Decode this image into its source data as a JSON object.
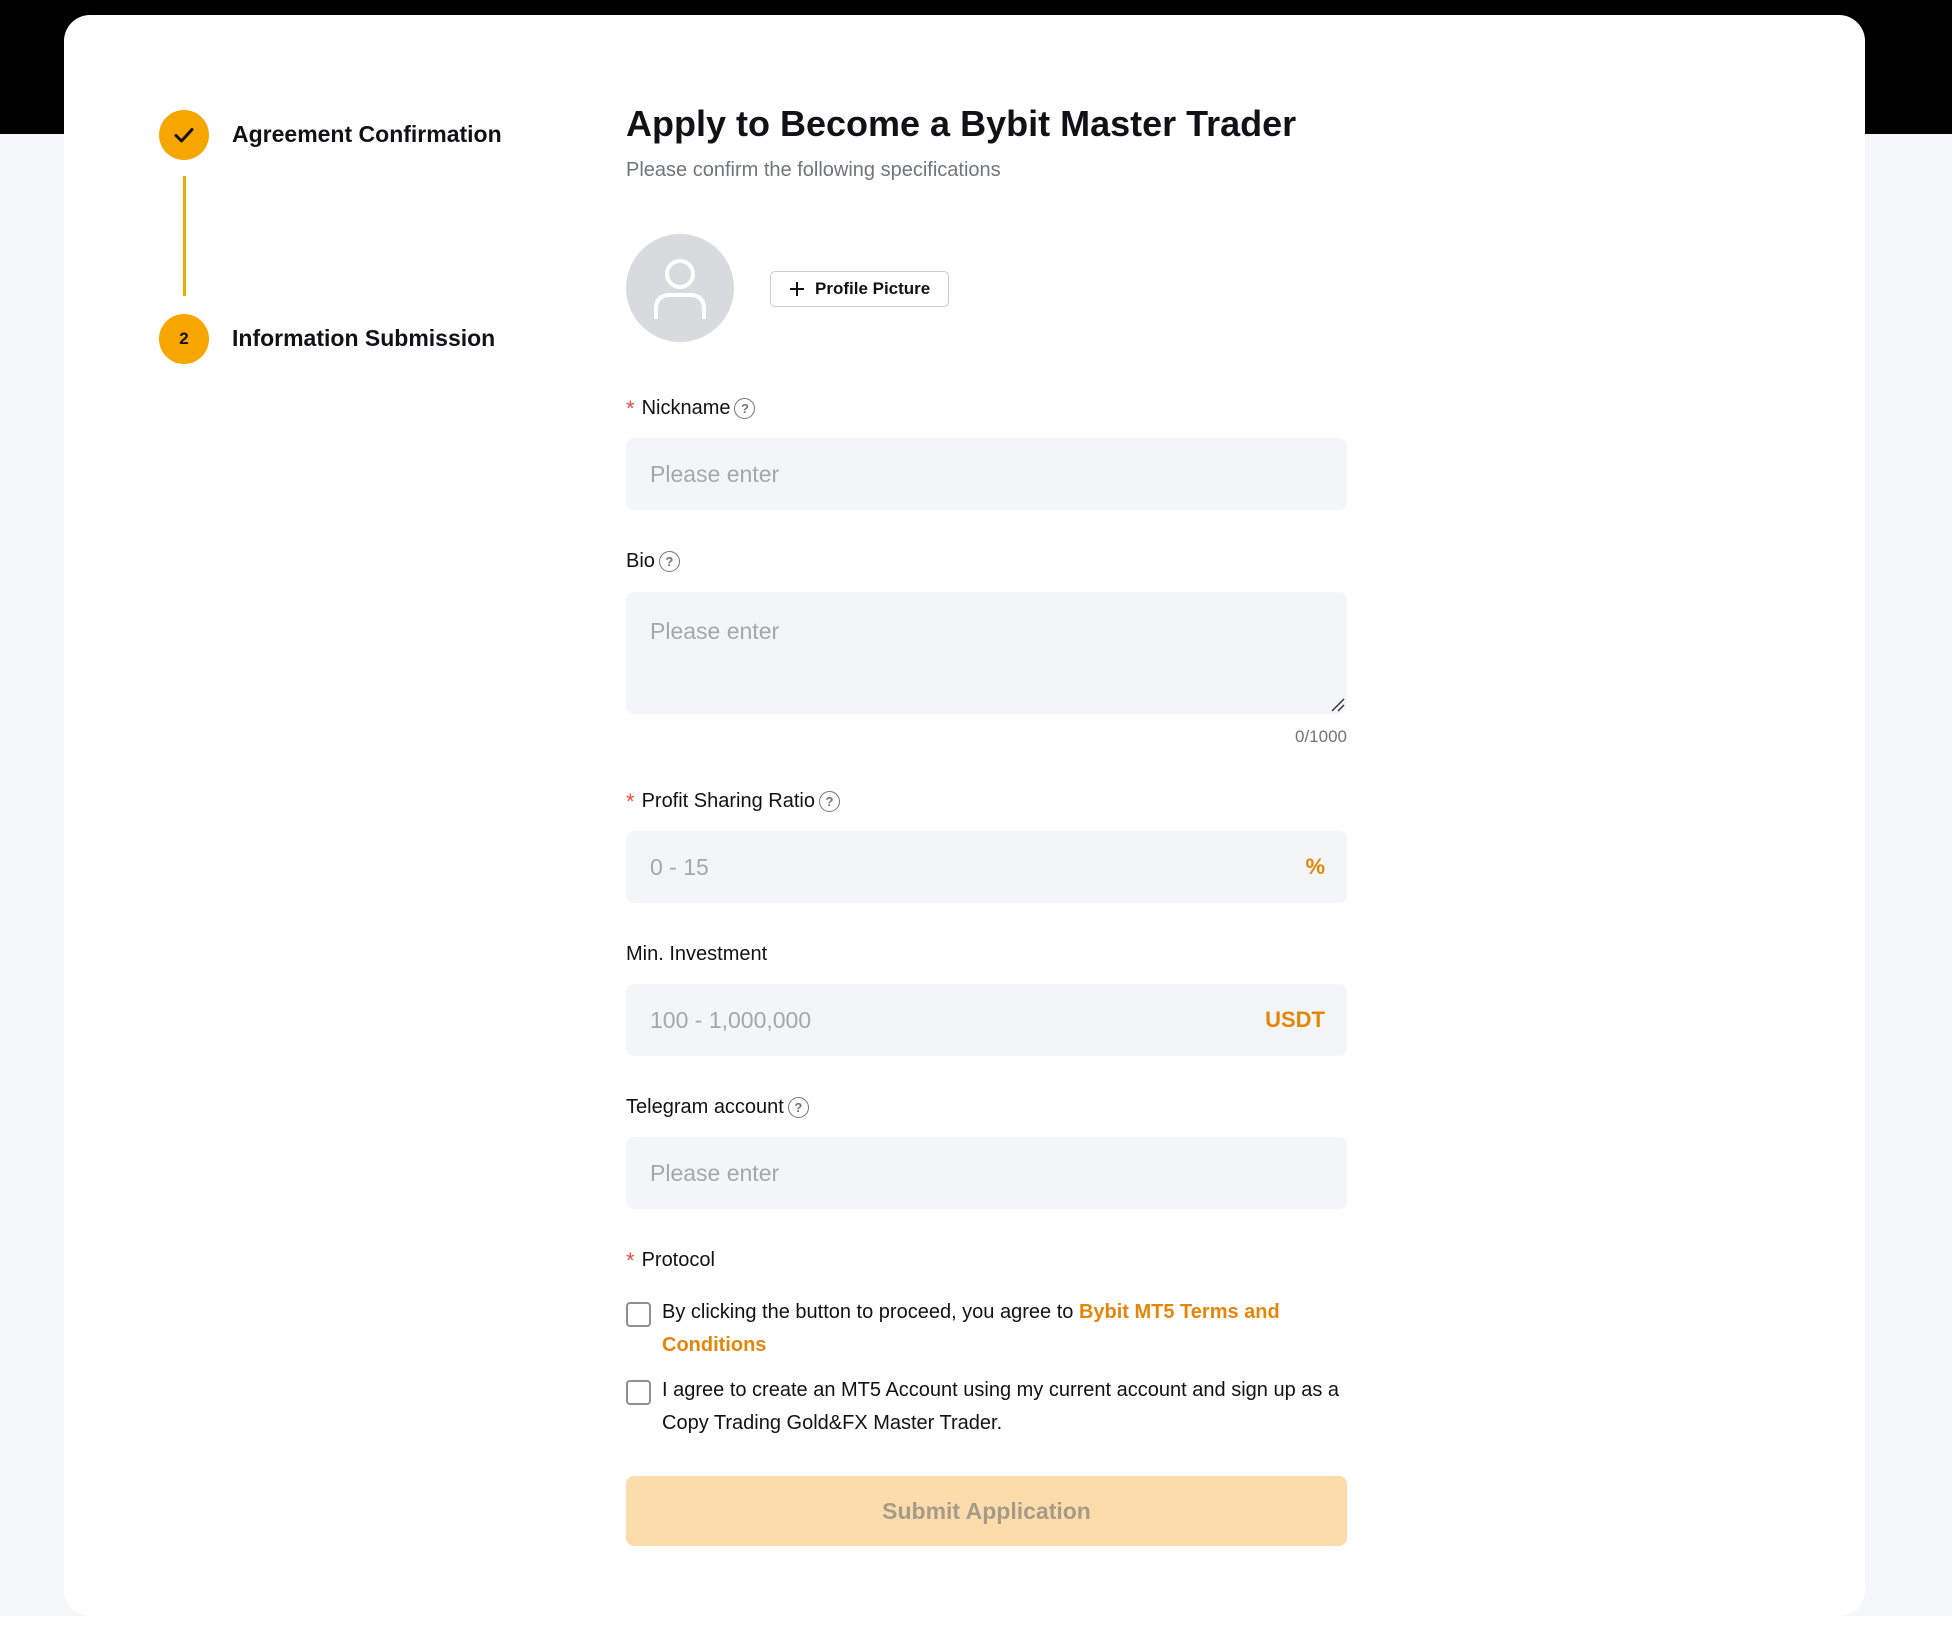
{
  "stepper": {
    "step1": {
      "label": "Agreement Confirmation",
      "state": "completed"
    },
    "step2": {
      "number": "2",
      "label": "Information Submission",
      "state": "active"
    }
  },
  "form": {
    "title": "Apply to Become a Bybit Master Trader",
    "subtitle": "Please confirm the following specifications",
    "profile_picture_button": "Profile Picture",
    "nickname": {
      "label": "Nickname",
      "placeholder": "Please enter",
      "required": true
    },
    "bio": {
      "label": "Bio",
      "placeholder": "Please enter",
      "counter": "0/1000"
    },
    "profit_sharing": {
      "label": "Profit Sharing Ratio",
      "placeholder": "0 - 15",
      "suffix": "%",
      "required": true
    },
    "min_investment": {
      "label": "Min. Investment",
      "placeholder": "100 - 1,000,000",
      "suffix": "USDT"
    },
    "telegram": {
      "label": "Telegram account",
      "placeholder": "Please enter"
    },
    "protocol": {
      "label": "Protocol",
      "required": true,
      "agreement1_prefix": "By clicking the button to proceed, you agree to ",
      "agreement1_link": "Bybit MT5 Terms and Conditions",
      "agreement2": "I agree to create an MT5 Account using my current account and sign up as a Copy Trading Gold&FX Master Trader."
    },
    "submit_label": "Submit Application"
  },
  "colors": {
    "accent": "#f7a600",
    "link": "#e4860a",
    "required": "#f1493f",
    "submit_disabled_bg": "#fcdcab"
  }
}
